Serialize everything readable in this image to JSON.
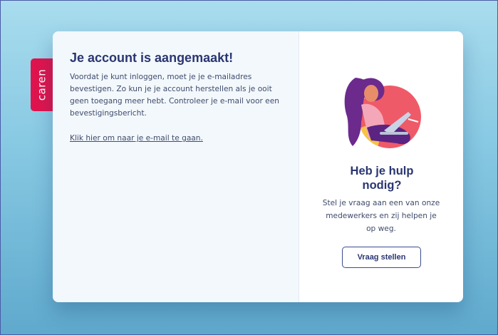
{
  "brand": {
    "name": "caren"
  },
  "confirmation": {
    "title": "Je account is aangemaakt!",
    "body": "Voordat je kunt inloggen, moet je je e-mailadres bevestigen. Zo kun je je account herstellen als je ooit geen toegang meer hebt. Controleer je e-mail voor een bevestigingsbericht.",
    "link_label": "Klik hier om naar je e-mail te gaan."
  },
  "help": {
    "title": "Heb je hulp nodig?",
    "body": "Stel je vraag aan een van onze medewerkers en zij helpen je op weg.",
    "button_label": "Vraag stellen",
    "illustration_icon": "woman-with-laptop-icon"
  },
  "colors": {
    "brand": "#e0144e",
    "heading": "#2a3671",
    "text": "#3f4b6b",
    "accent_circle": "#ef5a68"
  }
}
